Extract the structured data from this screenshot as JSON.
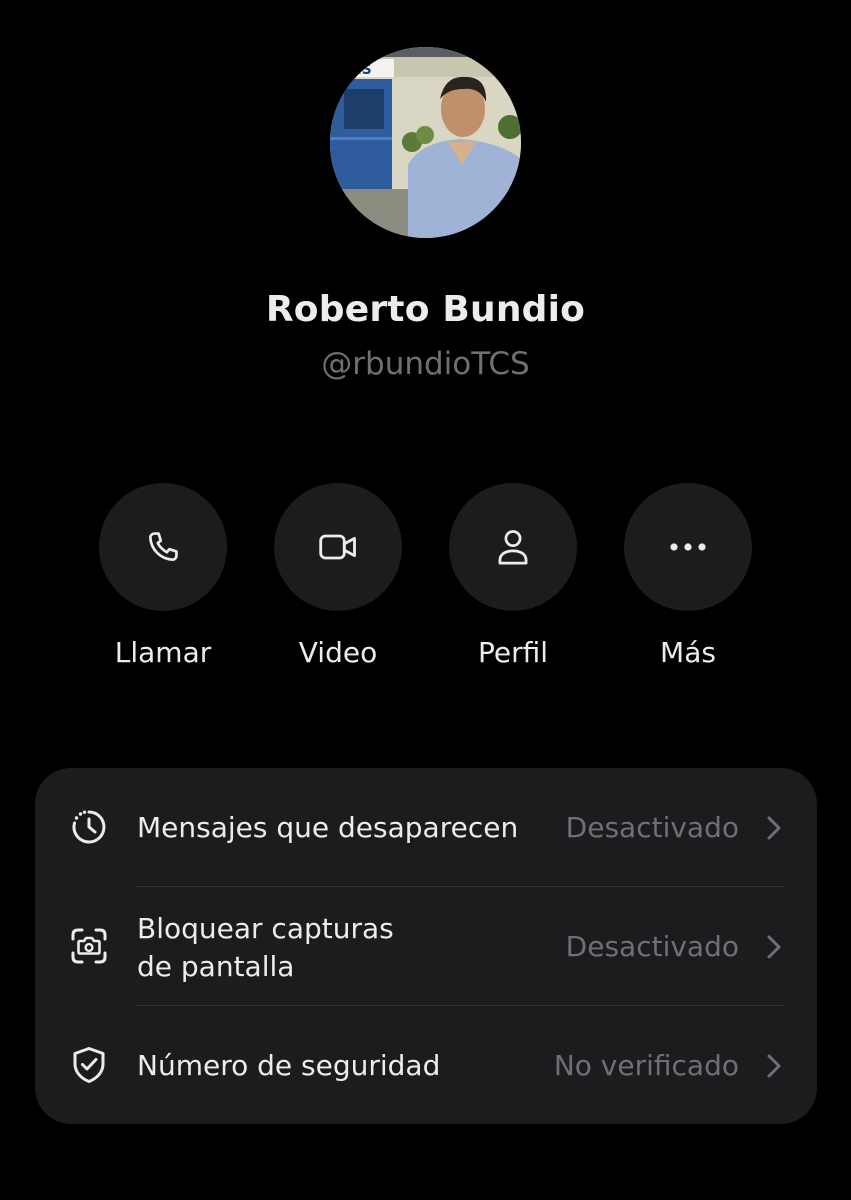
{
  "profile": {
    "name": "Roberto Bundio",
    "handle": "@rbundioTCS",
    "avatar_sign_text": "ES"
  },
  "actions": [
    {
      "label": "Llamar",
      "icon": "phone-icon"
    },
    {
      "label": "Video",
      "icon": "video-camera-icon"
    },
    {
      "label": "Perfil",
      "icon": "person-icon"
    },
    {
      "label": "Más",
      "icon": "more-dots-icon"
    }
  ],
  "settings": [
    {
      "label": "Mensajes que desaparecen",
      "value": "Desactivado",
      "icon": "timer-icon"
    },
    {
      "label_line1": "Bloquear capturas",
      "label_line2": "de pantalla",
      "value": "Desactivado",
      "icon": "screenshot-block-icon"
    },
    {
      "label": "Número de seguridad",
      "value": "No verificado",
      "icon": "shield-check-icon"
    }
  ],
  "colors": {
    "background": "#000000",
    "surface": "#1c1c1e",
    "primary_text": "#ececec",
    "secondary_text": "#6f6f74"
  }
}
